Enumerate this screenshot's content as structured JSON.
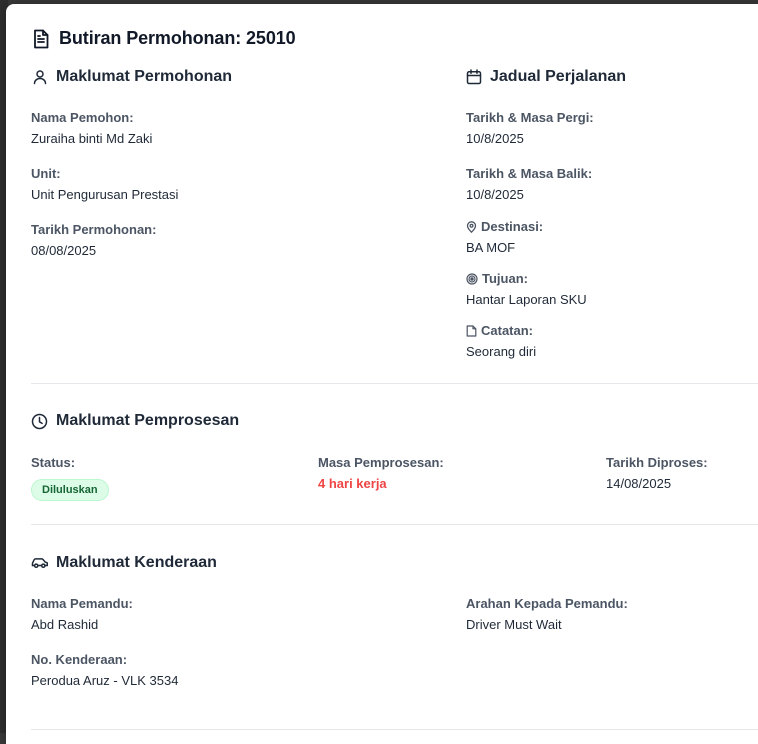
{
  "modal": {
    "title": "Butiran Permohonan: 25010"
  },
  "maklumat_permohonan": {
    "heading": "Maklumat Permohonan",
    "nama_label": "Nama Pemohon:",
    "nama_value": "Zuraiha binti Md Zaki",
    "unit_label": "Unit:",
    "unit_value": "Unit Pengurusan Prestasi",
    "tarikh_label": "Tarikh Permohonan:",
    "tarikh_value": "08/08/2025"
  },
  "jadual_perjalanan": {
    "heading": "Jadual Perjalanan",
    "pergi_label": "Tarikh & Masa Pergi:",
    "pergi_value": "10/8/2025",
    "balik_label": "Tarikh & Masa Balik:",
    "balik_value": "10/8/2025",
    "destinasi_label": "Destinasi:",
    "destinasi_value": "BA MOF",
    "tujuan_label": "Tujuan:",
    "tujuan_value": "Hantar Laporan SKU",
    "catatan_label": "Catatan:",
    "catatan_value": "Seorang diri"
  },
  "maklumat_pemprosesan": {
    "heading": "Maklumat Pemprosesan",
    "status_label": "Status:",
    "status_value": "Diluluskan",
    "masa_label": "Masa Pemprosesan:",
    "masa_value": "4 hari kerja",
    "diproses_label": "Tarikh Diproses:",
    "diproses_value": "14/08/2025"
  },
  "maklumat_kenderaan": {
    "heading": "Maklumat Kenderaan",
    "pemandu_label": "Nama Pemandu:",
    "pemandu_value": "Abd Rashid",
    "kenderaan_label": "No. Kenderaan:",
    "kenderaan_value": "Perodua Aruz - VLK 3534",
    "arahan_label": "Arahan Kepada Pemandu:",
    "arahan_value": "Driver Must Wait"
  },
  "colors": {
    "badge_bg": "#dcfce7",
    "badge_text": "#166534",
    "highlight_red": "#ef4444"
  }
}
